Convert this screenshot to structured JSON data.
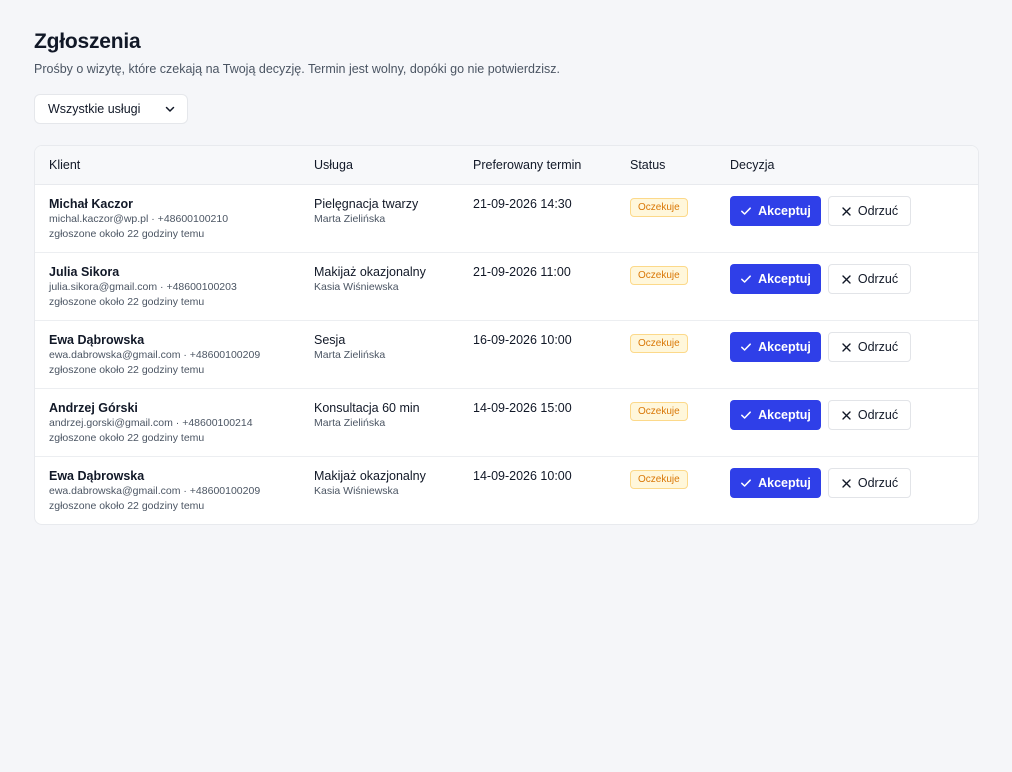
{
  "header": {
    "title": "Zgłoszenia",
    "subtitle": "Prośby o wizytę, które czekają na Twoją decyzję. Termin jest wolny, dopóki go nie potwierdzisz."
  },
  "filter": {
    "selected": "Wszystkie usługi",
    "icon": "chevron-down-icon"
  },
  "table": {
    "columns": {
      "client": "Klient",
      "service": "Usługa",
      "date": "Preferowany termin",
      "status": "Status",
      "decision": "Decyzja"
    },
    "accept_label": "Akceptuj",
    "reject_label": "Odrzuć",
    "accept_icon": "check-icon",
    "reject_icon": "close-icon",
    "rows": [
      {
        "name": "Michał Kaczor",
        "contact": "michal.kaczor@wp.pl · +48600100210",
        "requested": "zgłoszone około 22 godziny temu",
        "service": "Pielęgnacja twarzy",
        "staff": "Marta Zielińska",
        "date": "21-09-2026 14:30",
        "status": "Oczekuje"
      },
      {
        "name": "Julia Sikora",
        "contact": "julia.sikora@gmail.com · +48600100203",
        "requested": "zgłoszone około 22 godziny temu",
        "service": "Makijaż okazjonalny",
        "staff": "Kasia Wiśniewska",
        "date": "21-09-2026 11:00",
        "status": "Oczekuje"
      },
      {
        "name": "Ewa Dąbrowska",
        "contact": "ewa.dabrowska@gmail.com · +48600100209",
        "requested": "zgłoszone około 22 godziny temu",
        "service": "Sesja",
        "staff": "Marta Zielińska",
        "date": "16-09-2026 10:00",
        "status": "Oczekuje"
      },
      {
        "name": "Andrzej Górski",
        "contact": "andrzej.gorski@gmail.com · +48600100214",
        "requested": "zgłoszone około 22 godziny temu",
        "service": "Konsultacja 60 min",
        "staff": "Marta Zielińska",
        "date": "14-09-2026 15:00",
        "status": "Oczekuje"
      },
      {
        "name": "Ewa Dąbrowska",
        "contact": "ewa.dabrowska@gmail.com · +48600100209",
        "requested": "zgłoszone około 22 godziny temu",
        "service": "Makijaż okazjonalny",
        "staff": "Kasia Wiśniewska",
        "date": "14-09-2026 10:00",
        "status": "Oczekuje"
      }
    ]
  },
  "colors": {
    "background": "#f5f6f9",
    "accent": "#2f3fe8",
    "pending_text": "#d97706",
    "pending_bg": "#fff7db"
  }
}
